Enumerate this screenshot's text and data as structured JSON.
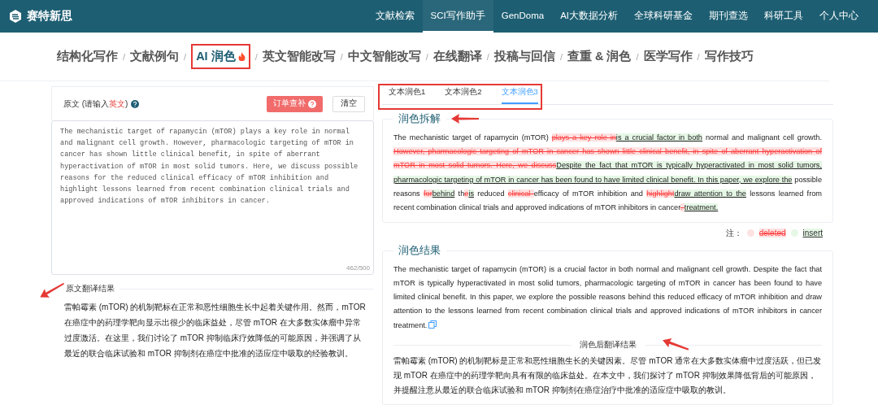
{
  "brand": {
    "name": "赛特新思"
  },
  "top_nav": [
    {
      "label": "文献检索",
      "selected": false
    },
    {
      "label": "SCI写作助手",
      "selected": true
    },
    {
      "label": "GenDoma",
      "selected": false
    },
    {
      "label": "AI大数据分析",
      "selected": false
    },
    {
      "label": "全球科研基金",
      "selected": false
    },
    {
      "label": "期刊查选",
      "selected": false
    },
    {
      "label": "科研工具",
      "selected": false
    },
    {
      "label": "个人中心",
      "selected": false
    }
  ],
  "sub_nav": {
    "separator": "/",
    "items": [
      {
        "label": "结构化写作",
        "selected": false
      },
      {
        "label": "文献例句",
        "selected": false
      },
      {
        "label": "AI 润色",
        "selected": true
      },
      {
        "label": "英文智能改写",
        "selected": false
      },
      {
        "label": "中文智能改写",
        "selected": false
      },
      {
        "label": "在线翻译",
        "selected": false
      },
      {
        "label": "投稿与回信",
        "selected": false
      },
      {
        "label": "查重 & 润色",
        "selected": false
      },
      {
        "label": "医学写作",
        "selected": false
      },
      {
        "label": "写作技巧",
        "selected": false
      }
    ]
  },
  "source": {
    "label_start": "原文 (请输入",
    "label_highlight": "英文",
    "label_end": ")",
    "order_button": "订单查补",
    "clear_button": "清空",
    "value": "The mechanistic target of rapamycin (mTOR) plays a key role in normal and malignant cell growth. However, pharmacologic targeting of mTOR in cancer has shown little clinical benefit, in spite of aberrant hyperactivation of mTOR in most solid tumors. Here, we discuss possible reasons for the reduced clinical efficacy of mTOR inhibition and highlight lessons learned from recent combination clinical trials and approved indications of mTOR inhibitors in cancer.",
    "counter": "462/500",
    "translation_title": "原文翻译结果",
    "translation": "雷帕霉素 (mTOR) 的机制靶标在正常和恶性细胞生长中起着关键作用。然而，mTOR 在癌症中的药理学靶向显示出很少的临床益处，尽管 mTOR 在大多数实体瘤中异常过度激活。在这里，我们讨论了 mTOR 抑制临床疗效降低的可能原因，并强调了从最近的联合临床试验和 mTOR 抑制剂在癌症中批准的适应症中吸取的经验教训。"
  },
  "tabs": [
    {
      "label": "文本润色1",
      "selected": false
    },
    {
      "label": "文本润色2",
      "selected": false
    },
    {
      "label": "文本润色3",
      "selected": true
    }
  ],
  "breakdown": {
    "title": "润色拆解",
    "segments": [
      {
        "kind": "same",
        "text": "The mechanistic target of rapamycin (mTOR) "
      },
      {
        "kind": "del",
        "text": "plays a key role in"
      },
      {
        "kind": "ins",
        "text": "is a crucial factor in both"
      },
      {
        "kind": "same",
        "text": " normal and malignant cell growth. "
      },
      {
        "kind": "del",
        "text": "However, pharmacologic targeting of mTOR in cancer has shown little clinical benefit, in spite of aberrant hyperactivation of mTOR in most solid tumors. Here, we discuss"
      },
      {
        "kind": "ins",
        "text": "Despite the fact that mTOR is typically hyperactivated in most solid tumors, pharmacologic targeting of mTOR in cancer has been found to have limited clinical benefit. In this paper, we explore the"
      },
      {
        "kind": "same",
        "text": " possible reasons "
      },
      {
        "kind": "del",
        "text": "for"
      },
      {
        "kind": "ins",
        "text": "behind"
      },
      {
        "kind": "same",
        "text": " th"
      },
      {
        "kind": "del",
        "text": "e"
      },
      {
        "kind": "ins",
        "text": "is"
      },
      {
        "kind": "same",
        "text": " reduced "
      },
      {
        "kind": "del",
        "text": "clinical "
      },
      {
        "kind": "same",
        "text": "efficacy of mTOR inhibition and "
      },
      {
        "kind": "del",
        "text": "highlight"
      },
      {
        "kind": "ins",
        "text": "draw attention to the"
      },
      {
        "kind": "same",
        "text": " lessons learned from recent combination clinical trials and approved indications of mTOR inhibitors in cancer"
      },
      {
        "kind": "del",
        "text": ". "
      },
      {
        "kind": "ins",
        "text": "treatment."
      }
    ]
  },
  "legend": {
    "label": "注：",
    "items": [
      {
        "kind": "del",
        "text": "deleted"
      },
      {
        "kind": "ins",
        "text": "insert"
      }
    ]
  },
  "result": {
    "title": "润色结果",
    "text": "The mechanistic target of rapamycin (mTOR) is a crucial factor in both normal and malignant cell growth. Despite the fact that mTOR is typically hyperactivated in most solid tumors, pharmacologic targeting of mTOR in cancer has been found to have limited clinical benefit. In this paper, we explore the possible reasons behind this reduced efficacy of mTOR inhibition and draw attention to the lessons learned from recent combination clinical trials and approved indications of mTOR inhibitors in cancer treatment.",
    "translation_title": "润色后翻译结果",
    "translation": "雷帕霉素 (mTOR) 的机制靶标是正常和恶性细胞生长的关键因素。尽管 mTOR 通常在大多数实体瘤中过度活跃，但已发现 mTOR 在癌症中的药理学靶向具有有限的临床益处。在本文中，我们探讨了 mTOR 抑制效果降低背后的可能原因，并提醒注意从最近的联合临床试验和 mTOR 抑制剂在癌症治疗中批准的适应症中吸取的教训。"
  }
}
